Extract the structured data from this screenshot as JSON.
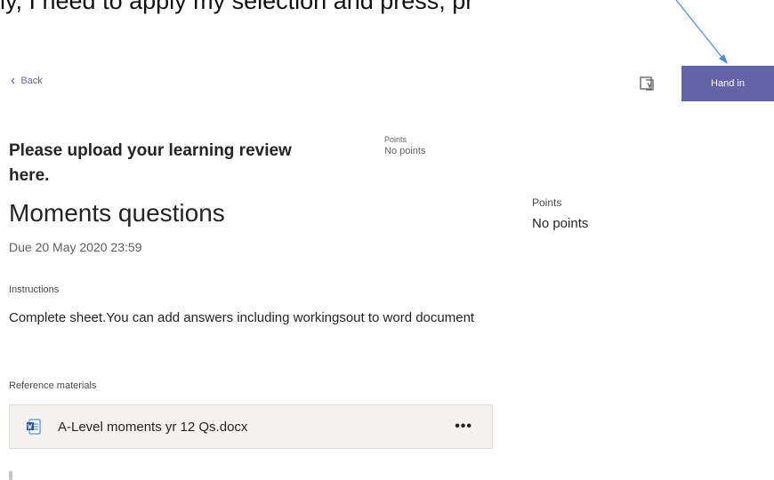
{
  "top_text": "ly, I need to apply my selection and press, pr",
  "nav": {
    "back_label": "Back"
  },
  "toolbar": {
    "immersive_icon": "immersive-reader-icon",
    "hand_in_label": "Hand in"
  },
  "assignment": {
    "heading": "Please upload your learning review here.",
    "title": "Moments questions",
    "due": "Due 20 May 2020 23:59",
    "points_label_small": "Points",
    "points_value_small": "No points",
    "points_label": "Points",
    "points_value": "No points",
    "instructions_label": "Instructions",
    "instructions_text": "Complete sheet.You can add answers including workingsout to word document",
    "reference_label": "Reference materials",
    "file_name": "A-Level moments yr 12 Qs.docx",
    "file_more": "•••"
  },
  "colors": {
    "accent": "#6264a7",
    "text": "#252423",
    "muted": "#605e5c",
    "card": "#f3f2f1",
    "arrow": "#4a8fd0"
  }
}
